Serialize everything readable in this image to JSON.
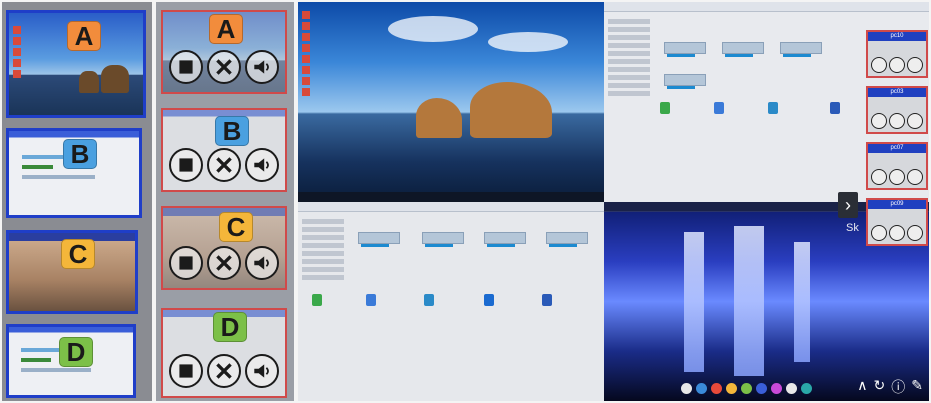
{
  "panel_thumbnails": {
    "cards": [
      {
        "label": "A",
        "label_color": "#f28c3c",
        "content": "desktop"
      },
      {
        "label": "B",
        "label_color": "#4aa0e0",
        "content": "file-explorer"
      },
      {
        "label": "C",
        "label_color": "#f4b63a",
        "content": "photo"
      },
      {
        "label": "D",
        "label_color": "#7cc048",
        "content": "file-explorer"
      }
    ]
  },
  "panel_controls": {
    "cards": [
      {
        "label": "A",
        "label_color": "#f28c3c",
        "content": "desktop",
        "buttons": [
          "stop-icon",
          "close-x-icon",
          "volume-icon"
        ]
      },
      {
        "label": "B",
        "label_color": "#4aa0e0",
        "content": "file-explorer",
        "buttons": [
          "stop-icon",
          "close-x-icon",
          "volume-icon"
        ]
      },
      {
        "label": "C",
        "label_color": "#f4b63a",
        "content": "photo",
        "buttons": [
          "stop-icon",
          "close-x-icon",
          "volume-icon"
        ]
      },
      {
        "label": "D",
        "label_color": "#7cc048",
        "content": "file-explorer",
        "buttons": [
          "stop-icon",
          "close-x-icon",
          "volume-icon"
        ]
      }
    ]
  },
  "big_screen": {
    "side_cards": [
      {
        "title": "pc10"
      },
      {
        "title": "pc03"
      },
      {
        "title": "pc07"
      },
      {
        "title": "pc09"
      }
    ],
    "overlay_text": "Sk",
    "colors": {
      "card_border": "#d04a4a",
      "thumb_border": "#1f3ec8",
      "title_bar": "#2040c0"
    }
  }
}
